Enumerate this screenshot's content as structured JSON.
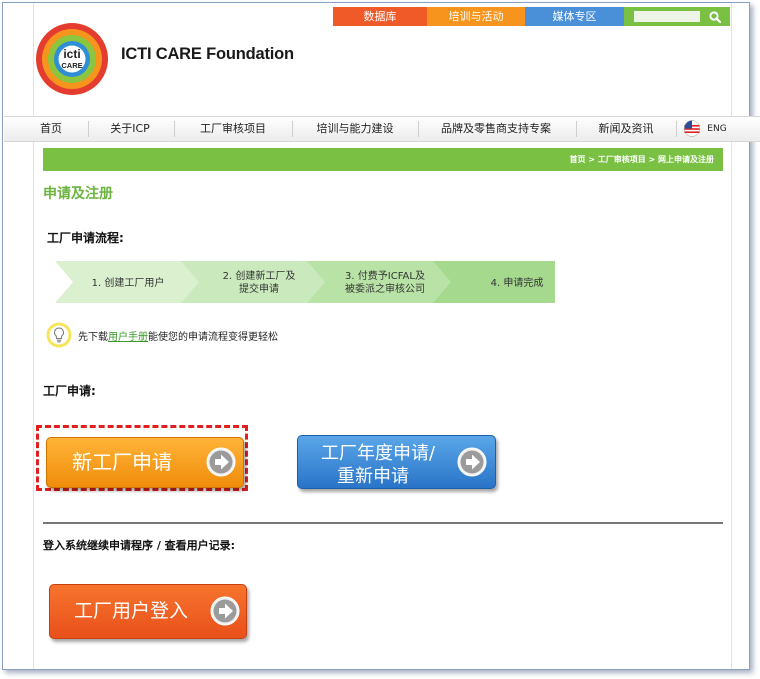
{
  "topnav": {
    "tabs": [
      {
        "label": "数据库",
        "color": "#f05a28"
      },
      {
        "label": "培训与活动",
        "color": "#f7941d"
      },
      {
        "label": "媒体专区",
        "color": "#4a90d9"
      }
    ],
    "search_icon": "search-icon",
    "search_color": "#7ac143"
  },
  "brand": {
    "logo_text_top": "icti",
    "logo_text_bottom": "CARE",
    "name": "ICTI CARE Foundation"
  },
  "mainnav": {
    "items": [
      "首页",
      "关于ICP",
      "工厂审核项目",
      "培训与能力建设",
      "品牌及零售商支持专案",
      "新闻及资讯"
    ],
    "lang": "ENG"
  },
  "breadcrumb": "首页 > 工厂审核项目 > 网上申请及注册",
  "page_title": "申请及注册",
  "process": {
    "heading": "工厂申请流程:",
    "steps": [
      {
        "line1": "1. 创建工厂用户",
        "line2": "",
        "color": "#daf0cf"
      },
      {
        "line1": "2. 创建新工厂及",
        "line2": "提交申请",
        "color": "#caeabd"
      },
      {
        "line1": "3. 付费予ICFAL及",
        "line2": "被委派之审核公司",
        "color": "#b8e2a6"
      },
      {
        "line1": "4. 申请完成",
        "line2": "",
        "color": "#a4d98e"
      }
    ]
  },
  "tip": {
    "before": "先下载",
    "link": "用户手册",
    "after": "能使您的申请流程变得更轻松",
    "icon": "lightbulb-icon"
  },
  "factory_apply": {
    "heading": "工厂申请:",
    "new_button": "新工厂申请",
    "annual_line1": "工厂年度申请/",
    "annual_line2": "重新申请",
    "new_color": "#f7a31c",
    "annual_color": "#3b88d8"
  },
  "login": {
    "heading": "登入系统继续申请程序 / 查看用户记录:",
    "button": "工厂用户登入",
    "color": "#f26522"
  },
  "accent": "#7ac143"
}
